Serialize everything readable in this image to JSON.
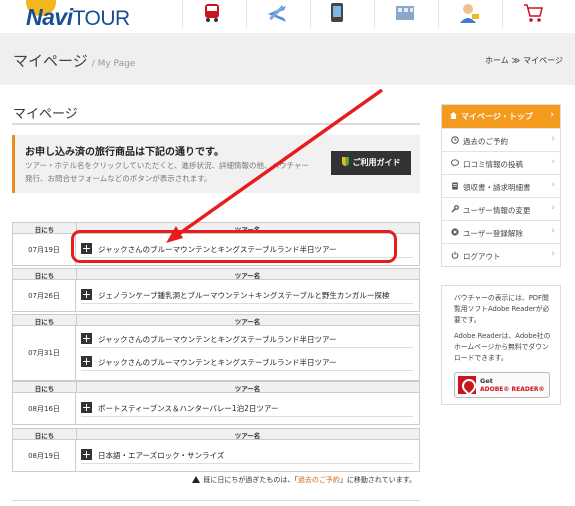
{
  "header": {
    "logo_bold": "Navi",
    "logo_light": "TOUR",
    "nav_icons": [
      "bus-icon",
      "airplane-icon",
      "smartphone-icon",
      "hotel-icon",
      "user-icon",
      "cart-icon"
    ]
  },
  "titlebar": {
    "title_jp": "マイページ",
    "title_en": "/ My Page",
    "breadcrumb_home": "ホーム",
    "breadcrumb_sep": "≫",
    "breadcrumb_current": "マイページ"
  },
  "main": {
    "heading": "マイページ",
    "notice_title": "お申し込み済の旅行商品は下記の通りです。",
    "notice_text": "ツアー・ホテル名をクリックしていただくと、進捗状況、詳細情報の他、バウチャー発行、お問合せフォームなどのボタンが表示されます。",
    "guide_button": "ご利用ガイド",
    "col_date": "日にち",
    "col_name": "ツアー名",
    "tours": [
      {
        "date": "07月19日",
        "items": [
          "ジャックさんのブルーマウンテンとキングステーブルランド半日ツアー"
        ]
      },
      {
        "date": "07月26日",
        "items": [
          "ジェノランケーブ鍾乳洞とブルーマウンテン＋キングステーブルと野生カンガルー探検"
        ]
      },
      {
        "date": "07月31日",
        "items": [
          "ジャックさんのブルーマウンテンとキングステーブルランド半日ツアー",
          "ジャックさんのブルーマウンテンとキングステーブルランド半日ツアー"
        ]
      },
      {
        "date": "08月16日",
        "items": [
          "ポートスティーブンス＆ハンターバレー1泊2日ツアー"
        ]
      },
      {
        "date": "08月19日",
        "items": [
          "日本語・エアーズロック・サンライズ"
        ]
      }
    ],
    "footnote_pre": "既に日にちが過ぎたものは、「",
    "footnote_link": "過去のご予約",
    "footnote_post": "」に移動されています。"
  },
  "sidebar": {
    "top_label": "マイページ・トップ",
    "items": [
      {
        "label": "過去のご予約",
        "icon": "clock-icon"
      },
      {
        "label": "口コミ情報の投稿",
        "icon": "speech-bubble-icon"
      },
      {
        "label": "領収書・請求明細書",
        "icon": "document-icon"
      },
      {
        "label": "ユーザー情報の変更",
        "icon": "wrench-icon"
      },
      {
        "label": "ユーザー登録解除",
        "icon": "cancel-icon"
      },
      {
        "label": "ログアウト",
        "icon": "power-icon"
      }
    ],
    "box_text1": "バウチャーの表示には、PDF閲覧用ソフトAdobe Readerが必要です。",
    "box_text2": "Adobe Readerは、Adobe社のホームページから無料でダウンロードできます。",
    "adobe_get": "Get",
    "adobe_reader": "ADOBE® READER®"
  },
  "colors": {
    "accent_orange": "#f49a1e",
    "logo_blue": "#1a4e93",
    "highlight_red": "#e81c1c"
  }
}
